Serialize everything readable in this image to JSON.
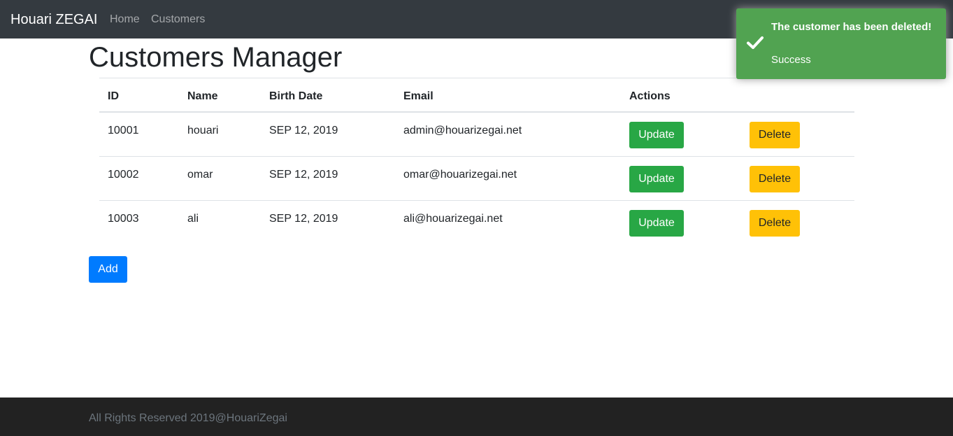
{
  "navbar": {
    "brand": "Houari ZEGAI",
    "links": [
      "Home",
      "Customers"
    ]
  },
  "page": {
    "title": "Customers Manager"
  },
  "table": {
    "headers": {
      "id": "ID",
      "name": "Name",
      "birth_date": "Birth Date",
      "email": "Email",
      "actions": "Actions"
    },
    "rows": [
      {
        "id": "10001",
        "name": "houari",
        "birth_date": "SEP 12, 2019",
        "email": "admin@houarizegai.net"
      },
      {
        "id": "10002",
        "name": "omar",
        "birth_date": "SEP 12, 2019",
        "email": "omar@houarizegai.net"
      },
      {
        "id": "10003",
        "name": "ali",
        "birth_date": "SEP 12, 2019",
        "email": "ali@houarizegai.net"
      }
    ],
    "update_label": "Update",
    "delete_label": "Delete"
  },
  "add_label": "Add",
  "footer": {
    "text": "All Rights Reserved 2019@HouariZegai"
  },
  "toast": {
    "title": "The customer has been deleted!",
    "message": "Success",
    "icon": "checkmark-icon",
    "color": "#51a351"
  },
  "colors": {
    "navbar": "#343a40",
    "update_button": "#28a745",
    "delete_button": "#ffc107",
    "add_button": "#007bff",
    "footer": "#222222"
  }
}
